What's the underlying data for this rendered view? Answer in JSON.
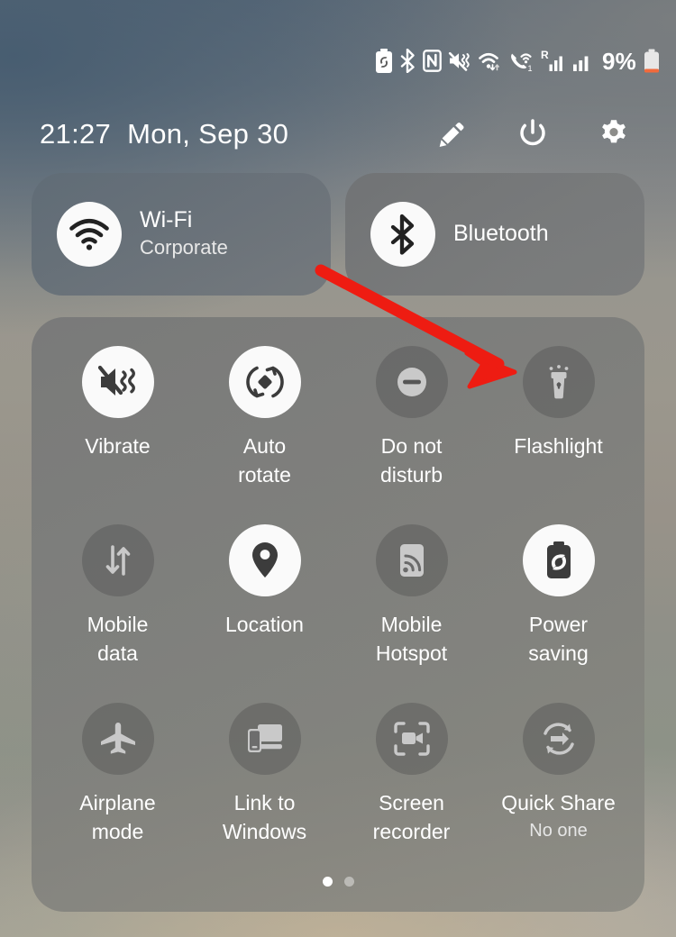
{
  "statusbar": {
    "icons": [
      {
        "name": "battery-saver-icon",
        "label": "Power saving"
      },
      {
        "name": "bluetooth-icon",
        "label": "Bluetooth"
      },
      {
        "name": "nfc-icon",
        "label": "NFC"
      },
      {
        "name": "mute-vibrate-icon",
        "label": "Sound off / vibrate"
      },
      {
        "name": "wifi-icon",
        "label": "Wi-Fi connected"
      },
      {
        "name": "call-wifi-icon",
        "label": "Wi-Fi calling"
      },
      {
        "name": "signal-roaming-icon",
        "label": "Roaming SIM 1 signal"
      },
      {
        "name": "signal-icon",
        "label": "SIM 2 signal"
      }
    ],
    "battery_percent": "9%"
  },
  "header": {
    "time": "21:27",
    "date": "Mon, Sep 30",
    "buttons": [
      {
        "name": "edit-button",
        "icon": "pencil-icon",
        "label": "Edit"
      },
      {
        "name": "power-button",
        "icon": "power-icon",
        "label": "Power"
      },
      {
        "name": "settings-button",
        "icon": "gear-icon",
        "label": "Settings"
      }
    ]
  },
  "connectivity": [
    {
      "name": "wifi-tile",
      "icon": "wifi-icon",
      "title": "Wi-Fi",
      "subtitle": "Corporate",
      "state": "on"
    },
    {
      "name": "bluetooth-tile",
      "icon": "bluetooth-icon",
      "title": "Bluetooth",
      "subtitle": "",
      "state": "on"
    }
  ],
  "quick_settings": [
    {
      "name": "tile-vibrate",
      "icon": "vibrate-icon",
      "label": "Vibrate",
      "sub": "",
      "state": "on"
    },
    {
      "name": "tile-auto-rotate",
      "icon": "auto-rotate-icon",
      "label": "Auto\nrotate",
      "sub": "",
      "state": "on"
    },
    {
      "name": "tile-do-not-disturb",
      "icon": "do-not-disturb-icon",
      "label": "Do not\ndisturb",
      "sub": "",
      "state": "off"
    },
    {
      "name": "tile-flashlight",
      "icon": "flashlight-icon",
      "label": "Flashlight",
      "sub": "",
      "state": "off"
    },
    {
      "name": "tile-mobile-data",
      "icon": "mobile-data-icon",
      "label": "Mobile\ndata",
      "sub": "",
      "state": "off"
    },
    {
      "name": "tile-location",
      "icon": "location-pin-icon",
      "label": "Location",
      "sub": "",
      "state": "on"
    },
    {
      "name": "tile-mobile-hotspot",
      "icon": "hotspot-icon",
      "label": "Mobile\nHotspot",
      "sub": "",
      "state": "off"
    },
    {
      "name": "tile-power-saving",
      "icon": "power-saving-icon",
      "label": "Power\nsaving",
      "sub": "",
      "state": "on"
    },
    {
      "name": "tile-airplane-mode",
      "icon": "airplane-icon",
      "label": "Airplane\nmode",
      "sub": "",
      "state": "off"
    },
    {
      "name": "tile-link-to-windows",
      "icon": "link-to-windows-icon",
      "label": "Link to\nWindows",
      "sub": "",
      "state": "off"
    },
    {
      "name": "tile-screen-recorder",
      "icon": "screen-recorder-icon",
      "label": "Screen\nrecorder",
      "sub": "",
      "state": "off"
    },
    {
      "name": "tile-quick-share",
      "icon": "quick-share-icon",
      "label": "Quick Share",
      "sub": "No one",
      "state": "off"
    }
  ],
  "pagination": {
    "total": 2,
    "active_index": 0
  },
  "annotation": {
    "name": "red-arrow",
    "points_to": "tile-flashlight",
    "color": "#ee1c12"
  },
  "colors": {
    "accent_red": "#ee1c12",
    "tile_on_bg": "#fafafa",
    "tile_off_bg": "rgba(80,80,80,0.42)",
    "panel_bg": "rgba(124,125,123,0.90)",
    "text_primary": "#ffffff",
    "battery_low": "#f26a3c"
  }
}
